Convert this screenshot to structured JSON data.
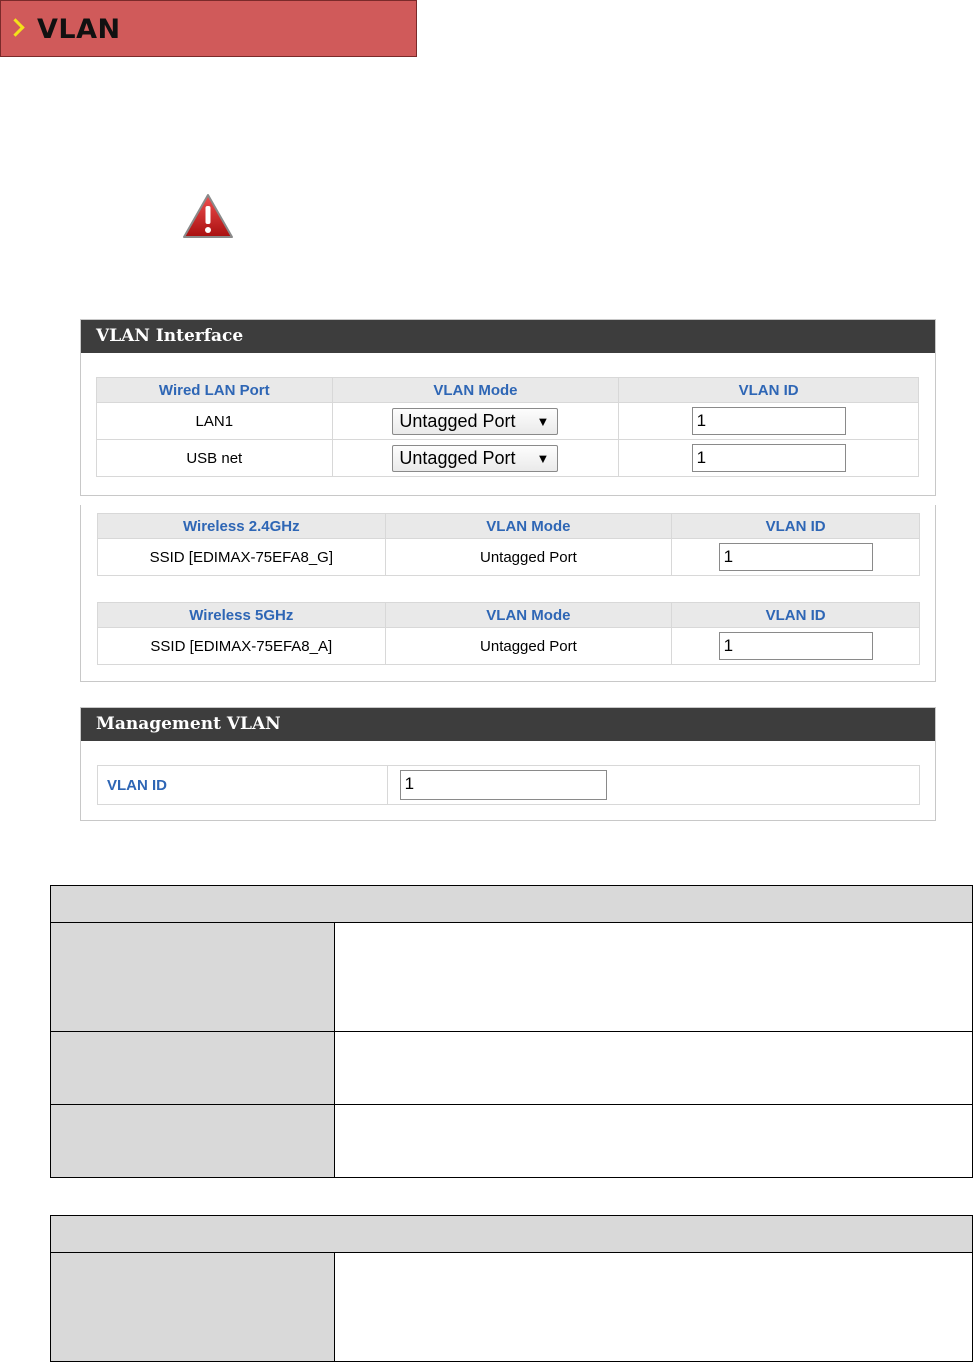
{
  "header": {
    "title": "VLAN"
  },
  "vlan_interface": {
    "title": "VLAN Interface",
    "wired_columns": [
      "Wired LAN Port",
      "VLAN Mode",
      "VLAN ID"
    ],
    "wired_rows": [
      {
        "port": "LAN1",
        "mode": "Untagged Port",
        "vlan_id": "1"
      },
      {
        "port": "USB net",
        "mode": "Untagged Port",
        "vlan_id": "1"
      }
    ],
    "wireless_24": {
      "columns": [
        "Wireless 2.4GHz",
        "VLAN Mode",
        "VLAN ID"
      ],
      "ssid": "SSID [EDIMAX-75EFA8_G]",
      "mode": "Untagged Port",
      "vlan_id": "1"
    },
    "wireless_5": {
      "columns": [
        "Wireless 5GHz",
        "VLAN Mode",
        "VLAN ID"
      ],
      "ssid": "SSID [EDIMAX-75EFA8_A]",
      "mode": "Untagged Port",
      "vlan_id": "1"
    }
  },
  "management_vlan": {
    "title": "Management VLAN",
    "label": "VLAN ID",
    "vlan_id": "1"
  },
  "icons": {
    "warning": "warning-icon",
    "chevron": "chevron-right-icon"
  },
  "colors": {
    "banner": "#d05a5a",
    "panel_header": "#3d3d3d",
    "column_header_text": "#2e66b5"
  }
}
